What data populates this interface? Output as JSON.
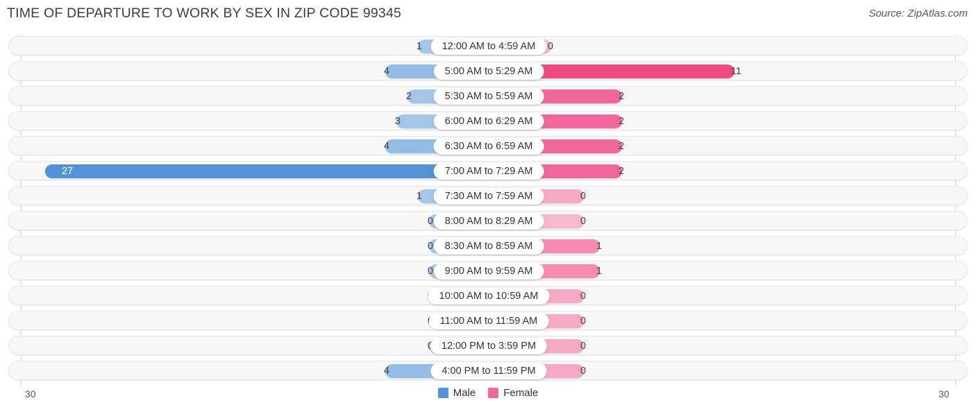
{
  "header": {
    "title": "TIME OF DEPARTURE TO WORK BY SEX IN ZIP CODE 99345",
    "source": "Source: ZipAtlas.com"
  },
  "legend": {
    "male_label": "Male",
    "female_label": "Female",
    "male_color": "#5093d8",
    "female_color": "#f2679b"
  },
  "axis": {
    "left_max": "30",
    "right_max": "30"
  },
  "chart_data": {
    "type": "bar",
    "title": "TIME OF DEPARTURE TO WORK BY SEX IN ZIP CODE 99345",
    "subtitle": "Source: ZipAtlas.com",
    "orientation": "horizontal-diverging",
    "xlabel": "",
    "ylabel": "",
    "xlim": [
      30,
      30
    ],
    "grid": false,
    "legend_position": "bottom-center",
    "categories": [
      "12:00 AM to 4:59 AM",
      "5:00 AM to 5:29 AM",
      "5:30 AM to 5:59 AM",
      "6:00 AM to 6:29 AM",
      "6:30 AM to 6:59 AM",
      "7:00 AM to 7:29 AM",
      "7:30 AM to 7:59 AM",
      "8:00 AM to 8:29 AM",
      "8:30 AM to 8:59 AM",
      "9:00 AM to 9:59 AM",
      "10:00 AM to 10:59 AM",
      "11:00 AM to 11:59 AM",
      "12:00 PM to 3:59 PM",
      "4:00 PM to 11:59 PM"
    ],
    "series": [
      {
        "name": "Male",
        "values": [
          1,
          4,
          2,
          3,
          4,
          27,
          1,
          0,
          0,
          0,
          0,
          0,
          0,
          4
        ]
      },
      {
        "name": "Female",
        "values": [
          0,
          11,
          2,
          2,
          2,
          2,
          0,
          0,
          1,
          1,
          0,
          0,
          0,
          0
        ]
      }
    ]
  },
  "rows": [
    {
      "label": "12:00 AM to 4:59 AM",
      "male": "1",
      "female": "0",
      "male_w": 88,
      "female_w": 78,
      "male_color": "#a3c6ea",
      "female_color": "#f5b8cd",
      "male_inside": false
    },
    {
      "label": "5:00 AM to 5:29 AM",
      "male": "4",
      "female": "11",
      "male_w": 135,
      "female_w": 342,
      "male_color": "#93bde6",
      "female_color": "#ef4a80",
      "male_inside": false
    },
    {
      "label": "5:30 AM to 5:59 AM",
      "male": "2",
      "female": "2",
      "male_w": 103,
      "female_w": 180,
      "male_color": "#a3c6ea",
      "female_color": "#f2679b",
      "male_inside": false
    },
    {
      "label": "6:00 AM to 6:29 AM",
      "male": "3",
      "female": "2",
      "male_w": 119,
      "female_w": 180,
      "male_color": "#a3c6ea",
      "female_color": "#f2679b",
      "male_inside": false
    },
    {
      "label": "6:30 AM to 6:59 AM",
      "male": "4",
      "female": "2",
      "male_w": 135,
      "female_w": 180,
      "male_color": "#93bde6",
      "female_color": "#f2679b",
      "male_inside": false
    },
    {
      "label": "7:00 AM to 7:29 AM",
      "male": "27",
      "female": "2",
      "male_w": 625,
      "female_w": 180,
      "male_color": "#5093d8",
      "female_color": "#f2679b",
      "male_inside": true
    },
    {
      "label": "7:30 AM to 7:59 AM",
      "male": "1",
      "female": "0",
      "male_w": 88,
      "female_w": 125,
      "male_color": "#a3c6ea",
      "female_color": "#f5a9c4",
      "male_inside": false
    },
    {
      "label": "8:00 AM to 8:29 AM",
      "male": "0",
      "female": "0",
      "male_w": 72,
      "female_w": 125,
      "male_color": "#a3c6ea",
      "female_color": "#f5b8cd",
      "male_inside": false
    },
    {
      "label": "8:30 AM to 8:59 AM",
      "male": "0",
      "female": "1",
      "male_w": 72,
      "female_w": 148,
      "male_color": "#a3c6ea",
      "female_color": "#f58bb2",
      "male_inside": false
    },
    {
      "label": "9:00 AM to 9:59 AM",
      "male": "0",
      "female": "1",
      "male_w": 72,
      "female_w": 148,
      "male_color": "#a3c6ea",
      "female_color": "#f58bb2",
      "male_inside": false
    },
    {
      "label": "10:00 AM to 10:59 AM",
      "male": "0",
      "female": "0",
      "male_w": 72,
      "female_w": 125,
      "male_color": "#a3c6ea",
      "female_color": "#f5a9c4",
      "male_inside": false
    },
    {
      "label": "11:00 AM to 11:59 AM",
      "male": "0",
      "female": "0",
      "male_w": 72,
      "female_w": 125,
      "male_color": "#a3c6ea",
      "female_color": "#f5a9c4",
      "male_inside": false
    },
    {
      "label": "12:00 PM to 3:59 PM",
      "male": "0",
      "female": "0",
      "male_w": 72,
      "female_w": 125,
      "male_color": "#a3c6ea",
      "female_color": "#f5a9c4",
      "male_inside": false
    },
    {
      "label": "4:00 PM to 11:59 PM",
      "male": "4",
      "female": "0",
      "male_w": 135,
      "female_w": 125,
      "male_color": "#93bde6",
      "female_color": "#f5a9c4",
      "male_inside": false
    }
  ]
}
